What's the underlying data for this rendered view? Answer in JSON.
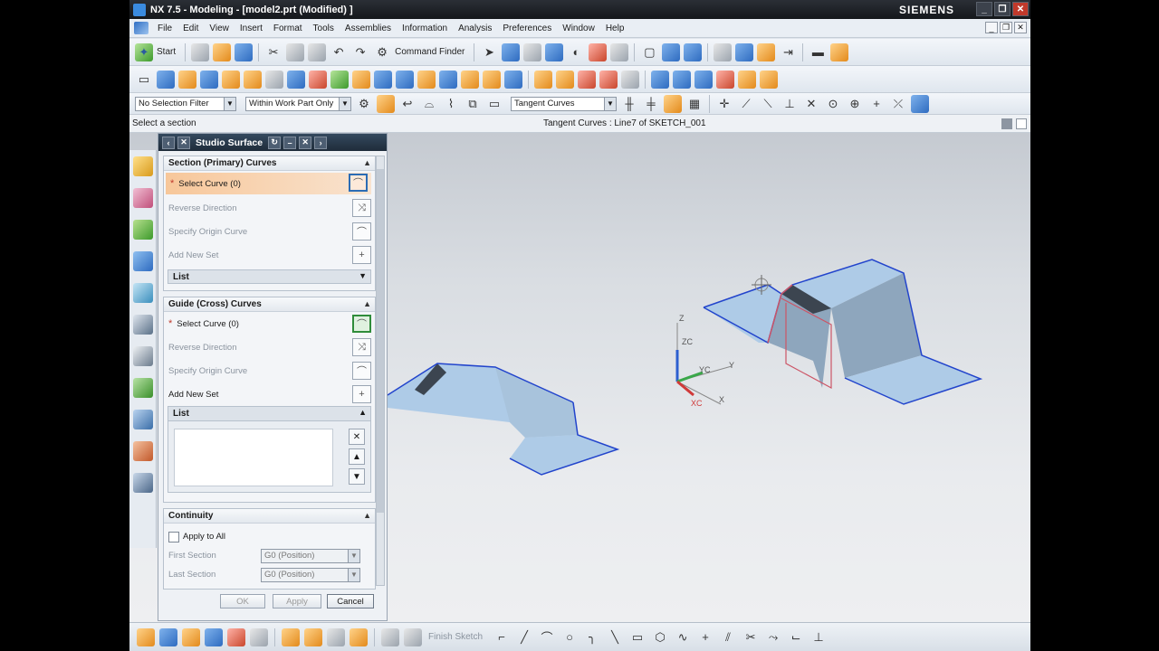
{
  "window": {
    "title": "NX 7.5 - Modeling - [model2.prt (Modified) ]",
    "brand": "SIEMENS",
    "controls": [
      "_",
      "❐",
      "✕"
    ]
  },
  "menu": {
    "items": [
      "File",
      "Edit",
      "View",
      "Insert",
      "Format",
      "Tools",
      "Assemblies",
      "Information",
      "Analysis",
      "Preferences",
      "Window",
      "Help"
    ]
  },
  "toolbar": {
    "start_label": "Start",
    "command_finder": "Command Finder"
  },
  "selection_bar": {
    "filter": "No Selection Filter",
    "scope": "Within Work Part Only",
    "curve_rule": "Tangent Curves"
  },
  "cue": {
    "prompt": "Select a section",
    "status": "Tangent Curves : Line7 of SKETCH_001"
  },
  "dialog": {
    "title": "Studio Surface",
    "section_group": {
      "title": "Section (Primary) Curves",
      "select_curve": "Select Curve (0)",
      "reverse_direction": "Reverse Direction",
      "specify_origin": "Specify Origin Curve",
      "add_new_set": "Add New Set",
      "list": "List"
    },
    "guide_group": {
      "title": "Guide (Cross) Curves",
      "select_curve": "Select Curve (0)",
      "reverse_direction": "Reverse Direction",
      "specify_origin": "Specify Origin Curve",
      "add_new_set": "Add New Set",
      "list": "List"
    },
    "continuity": {
      "title": "Continuity",
      "apply_to_all": "Apply to All",
      "first_section_label": "First Section",
      "first_section_value": "G0 (Position)",
      "last_section_label": "Last Section",
      "last_section_value": "G0 (Position)"
    },
    "actions": {
      "ok": "OK",
      "apply": "Apply",
      "cancel": "Cancel"
    }
  },
  "viewport": {
    "triad_labels": {
      "z": "Z",
      "zc": "ZC",
      "y": "Y",
      "yc": "YC",
      "x": "X",
      "xc": "XC"
    }
  },
  "bottom_toolbar": {
    "finish_sketch": "Finish Sketch"
  },
  "colors": {
    "surface_fill": "#aecbe7",
    "surface_shade": "#8ea6bd",
    "edge": "#2244cc",
    "highlight": "#cc5566"
  }
}
